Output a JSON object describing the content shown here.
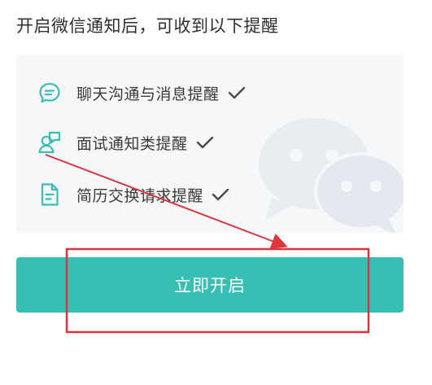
{
  "header": {
    "title": "开启微信通知后，可收到以下提醒"
  },
  "features": {
    "items": [
      {
        "icon": "chat-bubble-icon",
        "label": "聊天沟通与消息提醒"
      },
      {
        "icon": "interview-person-icon",
        "label": "面试通知类提醒"
      },
      {
        "icon": "document-icon",
        "label": "简历交换请求提醒"
      }
    ]
  },
  "cta": {
    "label": "立即开启"
  },
  "colors": {
    "accent": "#38bfb3",
    "panel_bg": "#f6f7f9",
    "annotation": "#d9363e"
  }
}
